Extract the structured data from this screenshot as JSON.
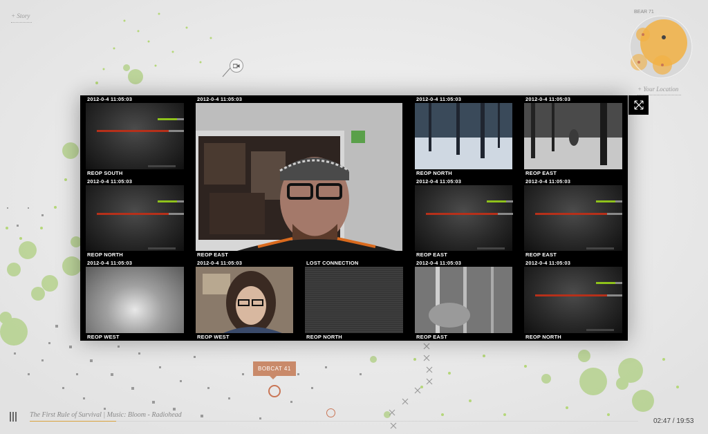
{
  "header": {
    "story_link": "+ Story"
  },
  "minimap": {
    "tag": "BEAR 71",
    "location_link": "+ Your Location"
  },
  "grid": {
    "cells": [
      {
        "timestamp": "2012-0-4 11:05:03",
        "label": "REOP  SOUTH",
        "kind": "static"
      },
      {
        "timestamp": "2012-0-4 11:05:03",
        "label": "REOP  EAST",
        "kind": "webcam-man"
      },
      {
        "timestamp": "2012-0-4 11:05:03",
        "label": "REOP  NORTH",
        "kind": "snow-forest"
      },
      {
        "timestamp": "2012-0-4 11:05:03",
        "label": "REOP  EAST",
        "kind": "snow-figure"
      },
      {
        "timestamp": "2012-0-4 11:05:03",
        "label": "REOP  NORTH",
        "kind": "static"
      },
      {
        "timestamp": "2012-0-4 11:05:03",
        "label": "REOP  EAST",
        "kind": "static"
      },
      {
        "timestamp": "2012-0-4 11:05:03",
        "label": "REOP  EAST",
        "kind": "static"
      },
      {
        "timestamp": "2012-0-4 11:05:03",
        "label": "REOP  WEST",
        "kind": "fog"
      },
      {
        "timestamp": "2012-0-4 11:05:03",
        "label": "REOP  WEST",
        "kind": "webcam-woman"
      },
      {
        "timestamp": "LOST CONNECTION",
        "label": "REOP  NORTH",
        "kind": "noise"
      },
      {
        "timestamp": "2012-0-4 11:05:03",
        "label": "REOP  EAST",
        "kind": "night-forest"
      },
      {
        "timestamp": "2012-0-4 11:05:03",
        "label": "REOP  NORTH",
        "kind": "static"
      }
    ]
  },
  "tooltip": {
    "label": "BOBCAT 41"
  },
  "player": {
    "credits": "The First Rule of Survival | Music: Bloom - Radiohead",
    "time": "02:47 / 19:53",
    "progress": 0.142
  },
  "colors": {
    "accent": "#d9a23c",
    "marker": "#c97656",
    "meter_green": "#8fc21b",
    "meter_red": "#b6301a"
  },
  "icons": {
    "close": "expand-x-icon",
    "pause": "pause-icon",
    "camera": "camera-icon"
  }
}
